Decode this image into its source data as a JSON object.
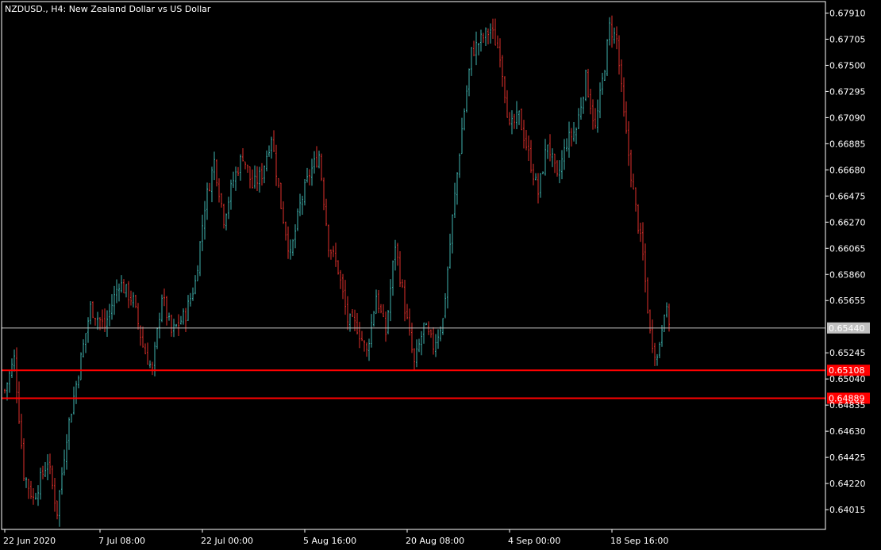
{
  "chart_title": "NZDUSD., H4:  New Zealand Dollar vs US Dollar",
  "colors": {
    "background": "#000000",
    "frame": "#ffffff",
    "bull": "#3fb5b0",
    "bear": "#e0312b",
    "level_line": "#ff0000",
    "current_line": "#c0c0c0",
    "current_label_bg": "#c0c0c0",
    "level_label_bg": "#ff0000"
  },
  "chart_data": {
    "type": "candlestick",
    "symbol": "NZDUSD.",
    "timeframe": "H4",
    "ylim": [
      0.6386,
      0.68
    ],
    "y_ticks": [
      "0.67910",
      "0.67705",
      "0.67500",
      "0.67295",
      "0.67090",
      "0.66885",
      "0.66680",
      "0.66475",
      "0.66270",
      "0.66065",
      "0.65860",
      "0.65655",
      "0.65245",
      "0.65040",
      "0.64835",
      "0.64630",
      "0.64425",
      "0.64220",
      "0.64015"
    ],
    "x_ticks": [
      "22 Jun 2020",
      "7 Jul 08:00",
      "22 Jul 00:00",
      "5 Aug 16:00",
      "20 Aug 08:00",
      "4 Sep 00:00",
      "18 Sep 16:00"
    ],
    "total_bars": 280,
    "current_price": "0.65440",
    "horizontal_levels": [
      {
        "value": "0.65108",
        "label": "0.65108"
      },
      {
        "value": "0.64889",
        "label": "0.64889"
      }
    ],
    "anchors": [
      [
        0,
        0.6495
      ],
      [
        4,
        0.652
      ],
      [
        8,
        0.643
      ],
      [
        12,
        0.641
      ],
      [
        18,
        0.644
      ],
      [
        22,
        0.64
      ],
      [
        26,
        0.646
      ],
      [
        30,
        0.65
      ],
      [
        36,
        0.656
      ],
      [
        42,
        0.6545
      ],
      [
        48,
        0.658
      ],
      [
        54,
        0.6565
      ],
      [
        58,
        0.653
      ],
      [
        62,
        0.651
      ],
      [
        66,
        0.657
      ],
      [
        70,
        0.654
      ],
      [
        76,
        0.6555
      ],
      [
        80,
        0.658
      ],
      [
        84,
        0.664
      ],
      [
        88,
        0.6675
      ],
      [
        92,
        0.663
      ],
      [
        96,
        0.666
      ],
      [
        100,
        0.668
      ],
      [
        104,
        0.6655
      ],
      [
        108,
        0.6665
      ],
      [
        112,
        0.6695
      ],
      [
        116,
        0.664
      ],
      [
        120,
        0.66
      ],
      [
        124,
        0.664
      ],
      [
        128,
        0.6665
      ],
      [
        132,
        0.668
      ],
      [
        136,
        0.661
      ],
      [
        140,
        0.659
      ],
      [
        144,
        0.655
      ],
      [
        148,
        0.6545
      ],
      [
        152,
        0.6525
      ],
      [
        156,
        0.657
      ],
      [
        160,
        0.654
      ],
      [
        164,
        0.661
      ],
      [
        168,
        0.656
      ],
      [
        172,
        0.6515
      ],
      [
        176,
        0.6545
      ],
      [
        180,
        0.653
      ],
      [
        184,
        0.655
      ],
      [
        188,
        0.663
      ],
      [
        192,
        0.67
      ],
      [
        196,
        0.676
      ],
      [
        200,
        0.677
      ],
      [
        204,
        0.6778
      ],
      [
        208,
        0.676
      ],
      [
        212,
        0.67
      ],
      [
        216,
        0.671
      ],
      [
        220,
        0.668
      ],
      [
        224,
        0.665
      ],
      [
        228,
        0.669
      ],
      [
        232,
        0.666
      ],
      [
        236,
        0.669
      ],
      [
        240,
        0.67
      ],
      [
        244,
        0.674
      ],
      [
        248,
        0.67
      ],
      [
        252,
        0.675
      ],
      [
        254,
        0.678
      ],
      [
        257,
        0.677
      ],
      [
        260,
        0.671
      ],
      [
        264,
        0.665
      ],
      [
        268,
        0.66
      ],
      [
        271,
        0.654
      ],
      [
        274,
        0.652
      ],
      [
        277,
        0.656
      ],
      [
        280,
        0.6545
      ]
    ]
  }
}
